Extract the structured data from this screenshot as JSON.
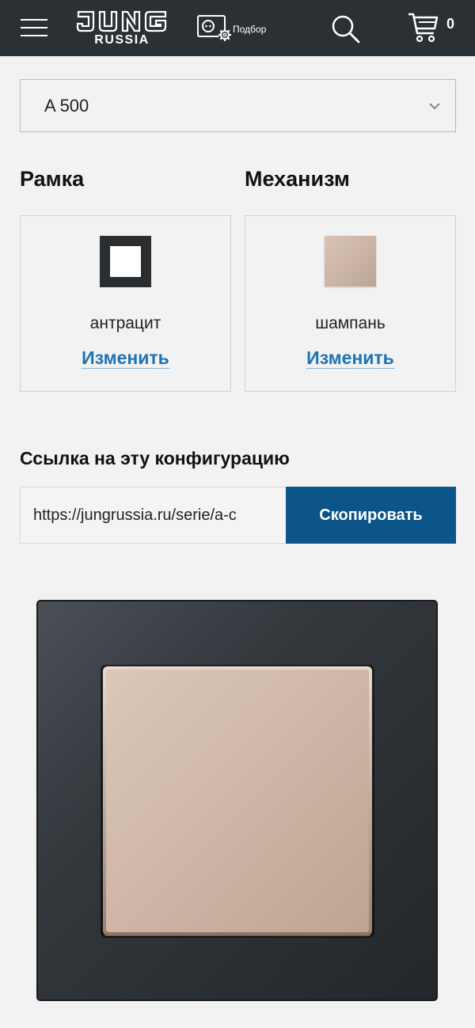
{
  "header": {
    "logo_main": "JUNG",
    "logo_sub": "RUSSIA",
    "podbor_label": "Подбор",
    "cart_count": "0"
  },
  "series_select": {
    "value": "A 500"
  },
  "frame": {
    "title": "Рамка",
    "color_name": "антрацит",
    "change_label": "Изменить"
  },
  "mechanism": {
    "title": "Механизм",
    "color_name": "шампань",
    "change_label": "Изменить"
  },
  "link_section": {
    "title": "Ссылка на эту конфигурацию",
    "url": "https://jungrussia.ru/serie/a-c",
    "copy_label": "Скопировать"
  },
  "colors": {
    "header_bg": "#2b3035",
    "accent_blue": "#1c73b5",
    "button_blue": "#0c5589",
    "anthracite": "#2b2e31",
    "champagne": "#ccb5a6"
  }
}
